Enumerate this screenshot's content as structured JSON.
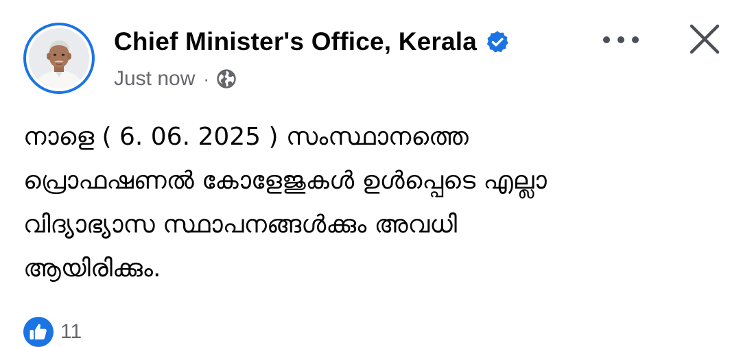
{
  "post": {
    "author_name": "Chief Minister's Office, Kerala",
    "timestamp": "Just now",
    "separator": "·",
    "privacy_icon": "globe-icon",
    "verified_icon": "verified-badge-icon",
    "more_icon": "more-options-icon",
    "close_icon": "close-icon",
    "text_lines": [
      "നാളെ ( 6. 06. 2025 ) സംസ്ഥാനത്തെ",
      "പ്രൊഫഷണൽ കോളേജുകൾ ഉൾപ്പെടെ എല്ലാ",
      "വിദ്യാഭ്യാസ സ്ഥാപനങ്ങൾക്കും അവധി",
      "ആയിരിക്കും."
    ],
    "reactions": {
      "icon": "like-icon",
      "count": "11"
    }
  },
  "colors": {
    "accent": "#1b74e4",
    "text_primary": "#050505",
    "text_secondary": "#65676b",
    "background": "#ffffff"
  }
}
